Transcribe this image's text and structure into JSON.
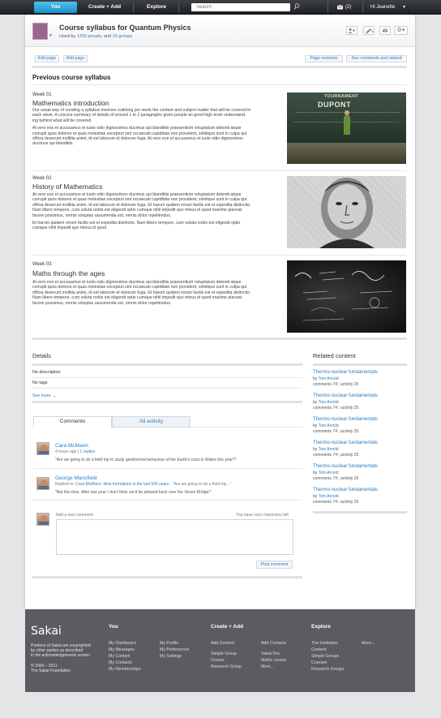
{
  "topbar": {
    "you": "You",
    "create_add": "Create + Add",
    "explore": "Explore",
    "search_placeholder": "Search",
    "messages_count": "(2)",
    "greeting": "Hi Jeanette"
  },
  "header": {
    "title": "Course syllabus for Quantum Physics",
    "used_by_prefix": "Used by",
    "used_by_people": "1250 people,",
    "used_by_and": "and",
    "used_by_groups": "15 groups"
  },
  "toolbar": {
    "edit_page": "Edit page",
    "add_page": "Add page",
    "page_revisions": "Page revisions",
    "see_comments": "See comments and related"
  },
  "syllabus": {
    "heading": "Previous course syllabus",
    "weeks": [
      {
        "week": "Week 01",
        "title": "Mathematics introduction",
        "p1": [
          "Our usual way of creating a syllabus involves outlining per week the content and subject matter that will be covered in",
          "each week. A concise summary of details of around 1 to 2 paragraphs gives people an good high-level understand-",
          "ing behind what will be covered."
        ],
        "p2": [
          "At vero eos et accusamus et iusto odio dignissimos ducimus qui blanditiis praesentium voluptatum deleniti atque",
          "corrupti quos dolores et quas molestias excepturi sint occaecati cupiditate non provident, similique sunt in culpa qui",
          "officia deserunt mollitia animi, id est laborum et dolorum fuga. At vero eos et accusamus et iusto odio dignissimos",
          "ducimus qui blanditiis."
        ],
        "image_caption_top": "TOURNAMENT",
        "image_caption_bottom": "DUPONT"
      },
      {
        "week": "Week 02",
        "title": "History of Mathematics",
        "p1": [
          "At vero eos et accusamus et iusto odio dignissimos ducimus qui blanditiis praesentium voluptatum deleniti atque",
          "corrupti quos dolores et quas molestias excepturi sint occaecati cupiditate non provident, similique sunt in culpa qui",
          "officia deserunt mollitia animi, id est laborum et dolorum fuga. Et harum quidem rerum facilis est et expedita distinctio.",
          "Nam libero tempore, cum soluta nobis est eligendi optio cumque nihil impedit quo minus id quod maxime placeat",
          "facere possimus, omnis voluptas assumenda est, omnis dolor repellendus."
        ],
        "p2": [
          "Et harum quidem rerum facilis est et expedita distinctio. Nam libero tempore, cum soluta nobis est eligendi optio",
          "cumque nihil impedit quo minus id quod"
        ]
      },
      {
        "week": "Week 03",
        "title": "Maths through the ages",
        "p1": [
          "At vero eos et accusamus et iusto odio dignissimos ducimus qui blanditiis praesentium voluptatum deleniti atque",
          "corrupti quos dolores et quas molestias excepturi sint occaecati cupiditate non provident, similique sunt in culpa qui",
          "officia deserunt mollitia animi, id est laborum et dolorum fuga. Et harum quidem rerum facilis est et expedita distinctio.",
          "Nam libero tempore, cum soluta nobis est eligendi optio cumque nihil impedit quo minus id quod maxime placeat",
          "facere possimus, omnis voluptas assumenda est, omnis dolor repellendus."
        ]
      }
    ]
  },
  "details": {
    "heading": "Details",
    "description": "No description",
    "tags": "No tags",
    "see_more": "See more"
  },
  "tabs": {
    "comments": "Comments",
    "activity": "All activity"
  },
  "comments": [
    {
      "name": "Cara McMann",
      "meta": "4 hours ago",
      "sep": "|",
      "replies": "1 replies",
      "text": "\"Are we going to do a field trip to study geothermal behaviour of the Earth's crust to Wales this year?\""
    },
    {
      "name": "George Mansfield",
      "replied_to": "Replied to:",
      "replied_link": "Cara McMann: New formations in the last 500 years",
      "replied_rest": " - \"Are we going to do a field trip...\"",
      "text": "\"Not this time. After last year I don't think we'd be allowed back over the Seven Bridge!\""
    }
  ],
  "new_comment": {
    "label": "Add a new comment:",
    "chars_left": "You have xxxx characters left",
    "post": "Post comment"
  },
  "related": {
    "heading": "Related content",
    "items": [
      {
        "title": "Thermo-nuclear fundamentals",
        "by": "by",
        "author": "Tom Arnold",
        "comments": "comments 74",
        "sep": "|",
        "activity": "activity 25"
      },
      {
        "title": "Thermo-nuclear fundamentals",
        "by": "by",
        "author": "Tom Arnold",
        "comments": "comments 74",
        "sep": "|",
        "activity": "activity 25"
      },
      {
        "title": "Thermo-nuclear fundamentals",
        "by": "by",
        "author": "Tom Arnold",
        "comments": "comments 74",
        "sep": "|",
        "activity": "activity 25"
      },
      {
        "title": "Thermo-nuclear fundamentals",
        "by": "by",
        "author": "Tom Arnold",
        "comments": "comments 74",
        "sep": "|",
        "activity": "activity 25"
      },
      {
        "title": "Thermo-nuclear fundamentals",
        "by": "by",
        "author": "Tom Arnold",
        "comments": "comments 74",
        "sep": "|",
        "activity": "activity 25"
      },
      {
        "title": "Thermo-nuclear fundamentals",
        "by": "by",
        "author": "Tom Arnold",
        "comments": "comments 74",
        "sep": "|",
        "activity": "activity 25"
      }
    ]
  },
  "footer": {
    "logo": "Sakai",
    "copyright": [
      "Portions of Sakai are copyrighted",
      "by other parties as described",
      "in the acknowledgements screen"
    ],
    "years": "© 2004 – 2011",
    "foundation": "The Sakai Foundation",
    "you_heading": "You",
    "you_col1": [
      "My Dashboard",
      "My Messages",
      "My Content",
      "My Contacts",
      "My Memberships"
    ],
    "you_col2": [
      "My Profile",
      "My Preferences",
      "My Settings"
    ],
    "create_heading": "Create + Add",
    "create_col1a": "Add Content",
    "create_col1b": [
      "Simple Group",
      "Course",
      "Research Group"
    ],
    "create_col2a": "Add Contacts",
    "create_col2b": [
      "Sakai Doc",
      "Maths course",
      "More..."
    ],
    "explore_heading": "Explore",
    "explore_col1": [
      "The Institution",
      "Content",
      "Simple Groups",
      "Courses",
      "Research Groups"
    ],
    "explore_more": "More..."
  },
  "colors": {
    "accent": "#2d7cc0",
    "nav_active": "#1a8fc9",
    "topbar": "#2b2d31",
    "footer": "#5a5c60"
  }
}
